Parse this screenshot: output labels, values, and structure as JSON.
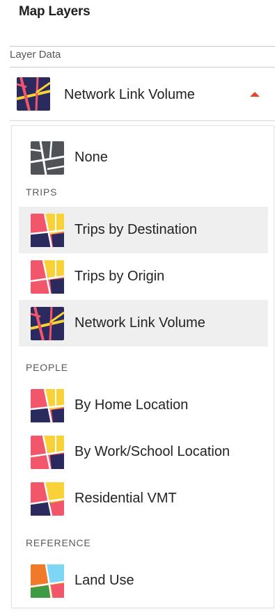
{
  "panel": {
    "title": "Map Layers"
  },
  "layer_data": {
    "label": "Layer Data",
    "selected": "Network Link Volume",
    "selected_icon": "network-link-volume-icon"
  },
  "menu": {
    "none": {
      "label": "None",
      "icon": "none-layer-icon"
    },
    "sections": [
      {
        "title": "TRIPS",
        "items": [
          {
            "label": "Trips by Destination",
            "icon": "trips-by-destination-icon"
          },
          {
            "label": "Trips by Origin",
            "icon": "trips-by-origin-icon"
          },
          {
            "label": "Network Link Volume",
            "icon": "network-link-volume-icon"
          }
        ]
      },
      {
        "title": "PEOPLE",
        "items": [
          {
            "label": "By Home Location",
            "icon": "by-home-location-icon"
          },
          {
            "label": "By Work/School Location",
            "icon": "by-work-school-location-icon"
          },
          {
            "label": "Residential VMT",
            "icon": "residential-vmt-icon"
          }
        ]
      },
      {
        "title": "REFERENCE",
        "items": [
          {
            "label": "Land Use",
            "icon": "land-use-icon"
          }
        ]
      }
    ]
  },
  "colors": {
    "accent_caret": "#e8432c",
    "hover_bg": "#efefef",
    "navy": "#2b2a5e",
    "coral": "#f2566b",
    "yellow": "#f8d237",
    "sky": "#7dd6f3",
    "orange": "#f07a2a",
    "green": "#3d9b45",
    "gray": "#4f5257"
  }
}
